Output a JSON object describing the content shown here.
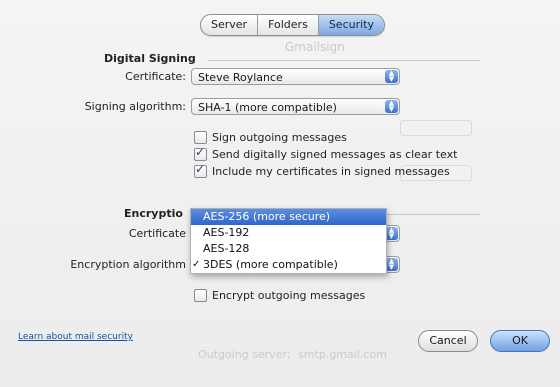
{
  "tabs": [
    {
      "label": "Server"
    },
    {
      "label": "Folders"
    },
    {
      "label": "Security"
    }
  ],
  "digital_signing": {
    "title": "Digital Signing",
    "certificate_label": "Certificate:",
    "certificate_value": "Steve Roylance",
    "algorithm_label": "Signing algorithm:",
    "algorithm_value": "SHA-1 (more compatible)",
    "options": [
      {
        "label": "Sign outgoing messages",
        "checked": false
      },
      {
        "label": "Send digitally signed messages as clear text",
        "checked": true
      },
      {
        "label": "Include my certificates in signed messages",
        "checked": true
      }
    ]
  },
  "encryption": {
    "title": "Encryptio",
    "certificate_label": "Certificate",
    "algorithm_label": "Encryption algorithm",
    "menu": [
      {
        "label": "AES-256 (more secure)",
        "highlighted": true,
        "selected": false
      },
      {
        "label": "AES-192",
        "highlighted": false,
        "selected": false
      },
      {
        "label": "AES-128",
        "highlighted": false,
        "selected": false
      },
      {
        "label": "3DES (more compatible)",
        "highlighted": false,
        "selected": true,
        "tick": "✓"
      }
    ],
    "encrypt_option": {
      "label": "Encrypt outgoing messages",
      "checked": false
    }
  },
  "footer": {
    "learn_link": "Learn about mail security",
    "cancel_label": "Cancel",
    "ok_label": "OK"
  },
  "background_ghost": {
    "heading": "Gmailsign",
    "line1": "Outgoing server:",
    "line2": "smtp.gmail.com"
  },
  "colors": {
    "accent": "#3a72c8",
    "highlight": "#2f66c9"
  }
}
